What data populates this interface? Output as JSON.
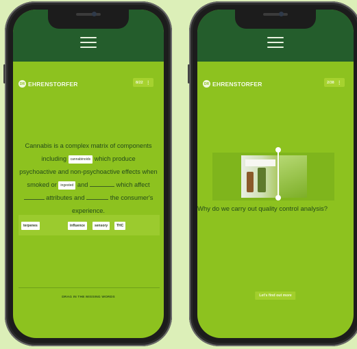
{
  "brand": "EHRENSTORFER",
  "brand_mark": "DR",
  "left_screen": {
    "counter": "8/22",
    "menu_dots": "⋮",
    "question_lines": [
      "Cannabis is a complex matrix of components",
      "including",
      "which produce",
      "psychoactive and non-psychoactive effects when",
      "smoked or",
      "and",
      "which affect",
      "attributes and",
      "the consumer's",
      "experience."
    ],
    "filled": {
      "blank1": "cannabinoids",
      "blank2": "ingested"
    },
    "options": [
      "terpenes",
      "influence",
      "sensory",
      "THC"
    ],
    "instruction": "DRAG IN THE MISSING WORDS"
  },
  "right_screen": {
    "counter": "2/38",
    "menu_dots": "⋮",
    "caption": "Why do we carry out quality control analysis?",
    "cta": "Let's find out more"
  },
  "colors": {
    "accent": "#8dc21f",
    "header": "#245d2c"
  }
}
